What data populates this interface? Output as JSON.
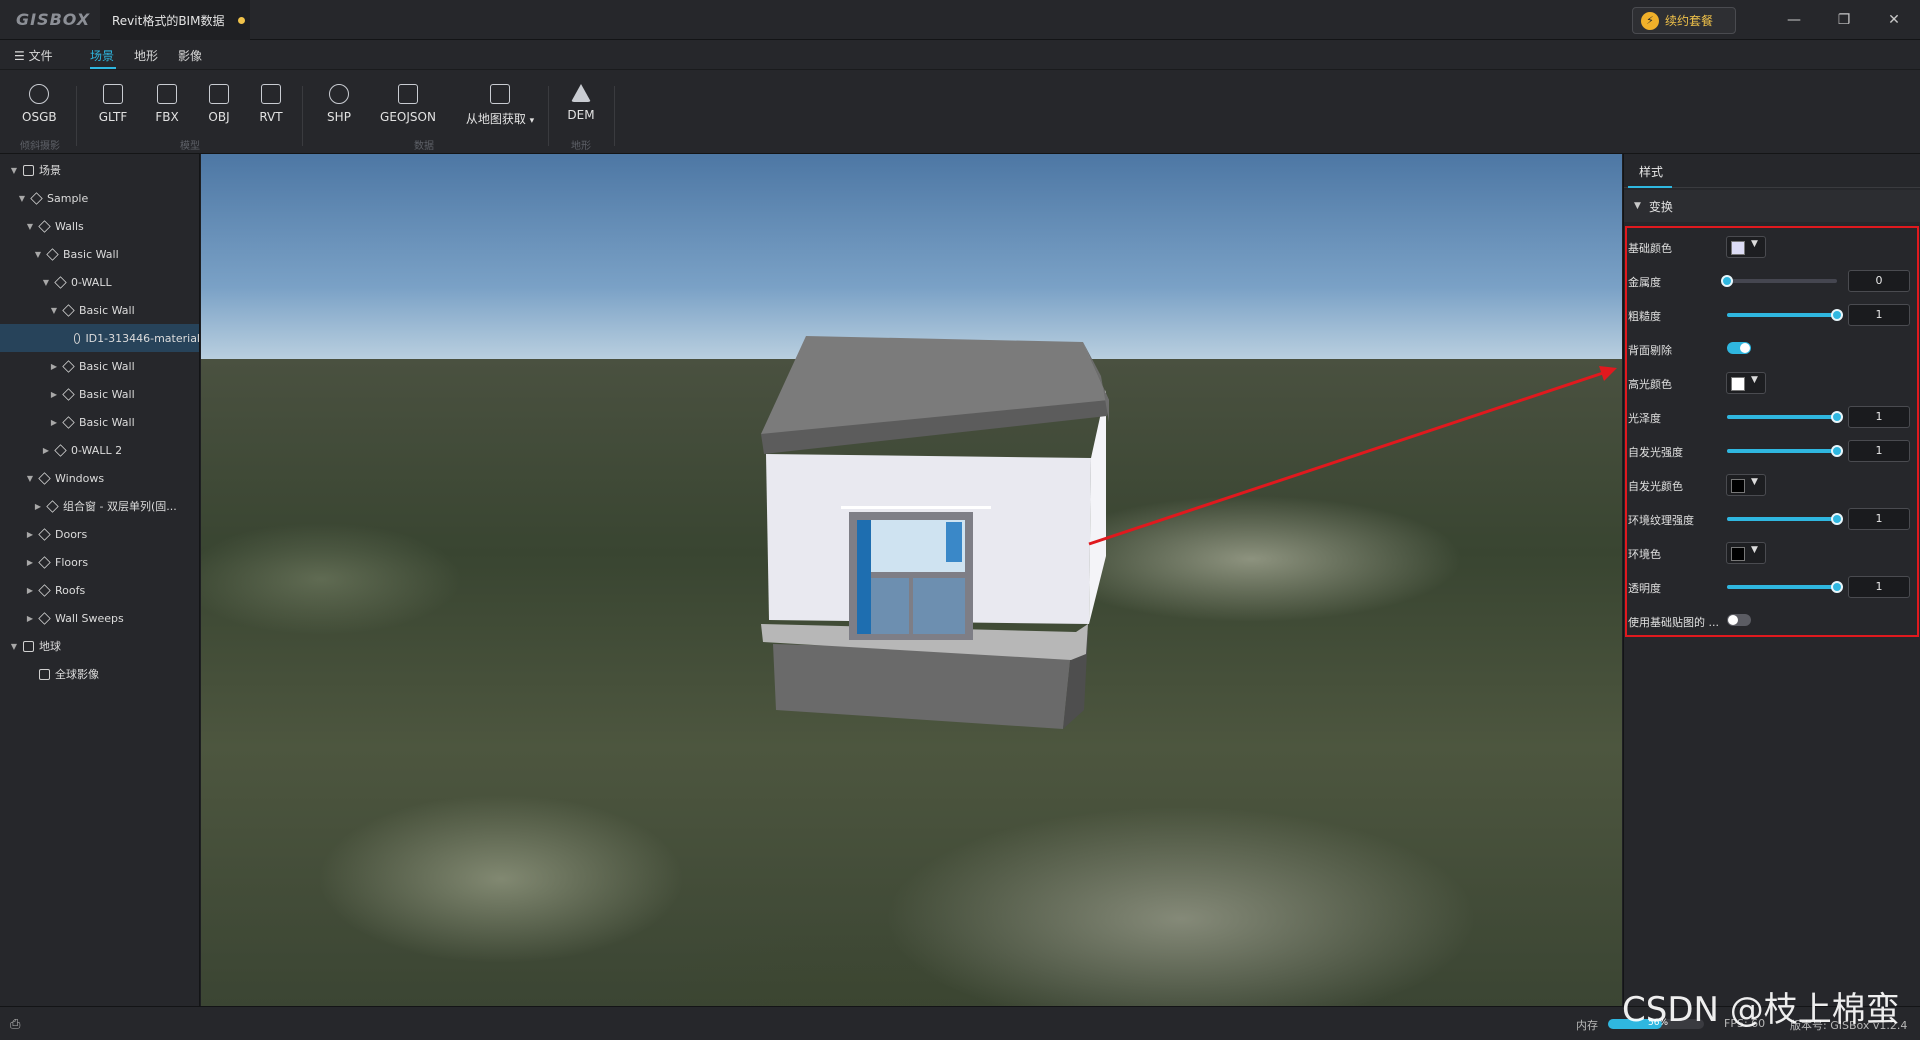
{
  "app": {
    "logo": "GISBOX",
    "doc_tab": "Revit格式的BIM数据",
    "plan_button": "续约套餐"
  },
  "menu": {
    "file": "文件",
    "tabs": [
      "场景",
      "地形",
      "影像"
    ],
    "active_tab": "场景"
  },
  "toolbar": {
    "tools": [
      {
        "label": "OSGB",
        "icon": "osgb-icon"
      },
      {
        "label": "GLTF",
        "icon": "gltf-icon"
      },
      {
        "label": "FBX",
        "icon": "fbx-icon"
      },
      {
        "label": "OBJ",
        "icon": "obj-icon"
      },
      {
        "label": "RVT",
        "icon": "rvt-icon"
      },
      {
        "label": "SHP",
        "icon": "shp-icon"
      },
      {
        "label": "GEOJSON",
        "icon": "geojson-icon"
      },
      {
        "label": "从地图获取",
        "icon": "map-fetch-icon"
      },
      {
        "label": "DEM",
        "icon": "dem-icon"
      }
    ],
    "groups": [
      "倾斜摄影",
      "模型",
      "数据",
      "地形"
    ]
  },
  "tree": {
    "nodes": [
      {
        "label": "场景",
        "expanded": true
      },
      {
        "label": "Sample",
        "expanded": true
      },
      {
        "label": "Walls",
        "expanded": true
      },
      {
        "label": "Basic Wall",
        "expanded": true
      },
      {
        "label": "0-WALL",
        "expanded": true
      },
      {
        "label": "Basic Wall",
        "expanded": true
      },
      {
        "label": "ID1-313446-material",
        "selected": true
      },
      {
        "label": "Basic Wall",
        "expanded": false
      },
      {
        "label": "Basic Wall",
        "expanded": false
      },
      {
        "label": "Basic Wall",
        "expanded": false
      },
      {
        "label": "0-WALL 2",
        "expanded": false
      },
      {
        "label": "Windows",
        "expanded": true
      },
      {
        "label": "组合窗 - 双层单列(固...",
        "expanded": false
      },
      {
        "label": "Doors",
        "expanded": false
      },
      {
        "label": "Floors",
        "expanded": false
      },
      {
        "label": "Roofs",
        "expanded": false
      },
      {
        "label": "Wall Sweeps",
        "expanded": false
      },
      {
        "label": "地球",
        "expanded": true
      },
      {
        "label": "全球影像"
      }
    ]
  },
  "panel": {
    "tab": "样式",
    "section": "变换",
    "props": [
      {
        "label": "基础颜色",
        "kind": "color",
        "color": "#dcdcf5"
      },
      {
        "label": "金属度",
        "kind": "slider",
        "value": "0",
        "fraction": 0
      },
      {
        "label": "粗糙度",
        "kind": "slider",
        "value": "1",
        "fraction": 1
      },
      {
        "label": "背面剔除",
        "kind": "toggle",
        "on": true
      },
      {
        "label": "高光颜色",
        "kind": "color",
        "color": "#ffffff"
      },
      {
        "label": "光泽度",
        "kind": "slider",
        "value": "1",
        "fraction": 1
      },
      {
        "label": "自发光强度",
        "kind": "slider",
        "value": "1",
        "fraction": 1
      },
      {
        "label": "自发光颜色",
        "kind": "color",
        "color": "#000000"
      },
      {
        "label": "环境纹理强度",
        "kind": "slider",
        "value": "1",
        "fraction": 1
      },
      {
        "label": "环境色",
        "kind": "color",
        "color": "#000000"
      },
      {
        "label": "透明度",
        "kind": "slider",
        "value": "1",
        "fraction": 1
      },
      {
        "label": "使用基础贴图的 ...",
        "kind": "toggle",
        "on": false
      }
    ]
  },
  "status": {
    "memory_label": "内存",
    "memory_value": "56%",
    "memory_fraction": 0.56,
    "fps": "FPS: 60",
    "version": "版本号: GISBox v1.2.4"
  },
  "watermark": "CSDN @枝上棉蛮",
  "colors": {
    "accent": "#2fb7e0",
    "annotation": "#e0191e"
  }
}
